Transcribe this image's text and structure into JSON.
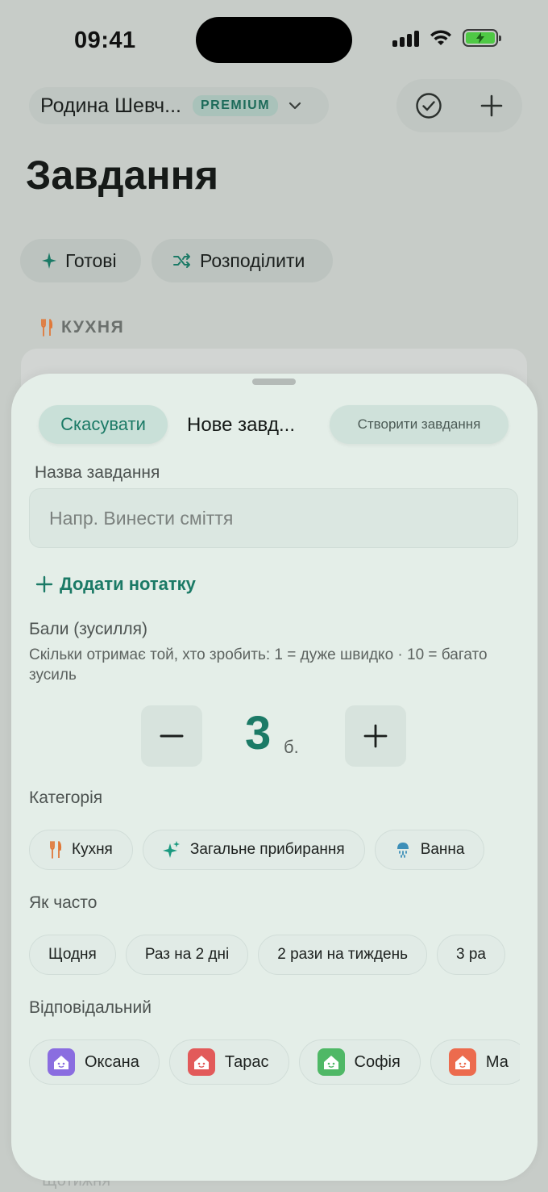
{
  "status_bar": {
    "time": "09:41"
  },
  "header": {
    "family_name": "Родина Шевч...",
    "plan_badge": "PREMIUM",
    "page_title": "Завдання"
  },
  "background": {
    "chips": [
      {
        "label": "Готові",
        "icon": "sparkle-icon"
      },
      {
        "label": "Розподілити",
        "icon": "shuffle-icon"
      }
    ],
    "section": {
      "label": "КУХНЯ",
      "icon": "fork-knife-icon"
    },
    "bottom_hint": "Щотижня"
  },
  "sheet": {
    "cancel_label": "Скасувати",
    "title": "Нове завд...",
    "create_label": "Створити завдання",
    "name_label": "Назва завдання",
    "name_placeholder": "Напр. Винести сміття",
    "name_value": "",
    "add_note_label": "Додати нотатку",
    "points": {
      "title": "Бали (зусилля)",
      "help": "Скільки отримає той, хто зробить: 1 = дуже швидко · 10 = багато зусиль",
      "value": "3",
      "unit": "б."
    },
    "category": {
      "title": "Категорія",
      "options": [
        {
          "label": "Кухня",
          "icon": "fork-knife-icon",
          "color": "#e0793a"
        },
        {
          "label": "Загальне прибирання",
          "icon": "sparkle-icon",
          "color": "#1b9a80"
        },
        {
          "label": "Ванна",
          "icon": "shower-icon",
          "color": "#3d8fb8"
        }
      ]
    },
    "frequency": {
      "title": "Як часто",
      "options": [
        "Щодня",
        "Раз на 2 дні",
        "2 рази на тиждень",
        "3 ра"
      ]
    },
    "assignee": {
      "title": "Відповідальний",
      "people": [
        {
          "name": "Оксана",
          "color": "#8a6de0"
        },
        {
          "name": "Тарас",
          "color": "#e25a5a"
        },
        {
          "name": "Софія",
          "color": "#4fb866"
        },
        {
          "name": "Ма",
          "color": "#ec6b4e"
        }
      ]
    }
  },
  "colors": {
    "accent": "#1b7a66",
    "sheet_bg": "#e4eee8",
    "dim_bg": "#c7ccc8"
  }
}
